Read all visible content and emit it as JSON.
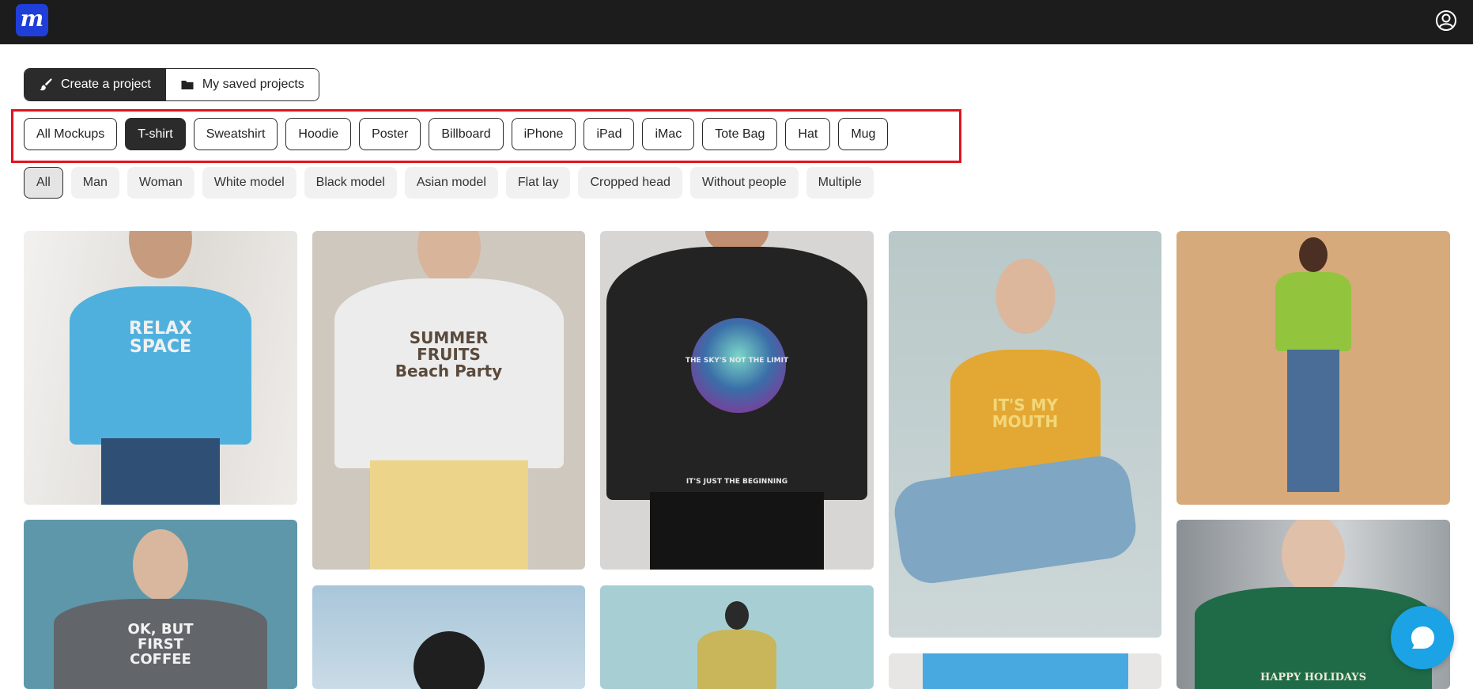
{
  "header": {
    "logo_text": "m",
    "brand_color": "#1f3fd8",
    "account_icon": "user-circle-icon"
  },
  "project_tabs": [
    {
      "label": "Create a project",
      "icon": "brush-icon",
      "active": true
    },
    {
      "label": "My saved projects",
      "icon": "folder-icon",
      "active": false
    }
  ],
  "categories": [
    {
      "label": "All Mockups",
      "active": false
    },
    {
      "label": "T-shirt",
      "active": true
    },
    {
      "label": "Sweatshirt",
      "active": false
    },
    {
      "label": "Hoodie",
      "active": false
    },
    {
      "label": "Poster",
      "active": false
    },
    {
      "label": "Billboard",
      "active": false
    },
    {
      "label": "iPhone",
      "active": false
    },
    {
      "label": "iPad",
      "active": false
    },
    {
      "label": "iMac",
      "active": false
    },
    {
      "label": "Tote Bag",
      "active": false
    },
    {
      "label": "Hat",
      "active": false
    },
    {
      "label": "Mug",
      "active": false
    }
  ],
  "filters": [
    {
      "label": "All",
      "active": true
    },
    {
      "label": "Man",
      "active": false
    },
    {
      "label": "Woman",
      "active": false
    },
    {
      "label": "White model",
      "active": false
    },
    {
      "label": "Black model",
      "active": false
    },
    {
      "label": "Asian model",
      "active": false
    },
    {
      "label": "Flat lay",
      "active": false
    },
    {
      "label": "Cropped head",
      "active": false
    },
    {
      "label": "Without people",
      "active": false
    },
    {
      "label": "Multiple",
      "active": false
    }
  ],
  "gallery": [
    {
      "print": "RELAX\nSPACE",
      "shirt_color": "#4fb0de",
      "bg": "#e9e7e4"
    },
    {
      "print": "SUMMER\nFRUITS\nBeach Party",
      "shirt_color": "#ececec",
      "bg": "#cfc8bf"
    },
    {
      "print": "THE SKY'S NOT THE LIMIT\nIT'S JUST THE BEGINNING",
      "shirt_color": "#232323",
      "bg": "#d8d6d4"
    },
    {
      "print": "IT'S MY\nMOUTH",
      "shirt_color": "#e3a834",
      "bg": "#b9c8c8"
    },
    {
      "print": "",
      "shirt_color": "#93c43e",
      "bg": "#d7aa7c"
    },
    {
      "print": "OK, BUT\nFIRST\nCOFFEE",
      "shirt_color": "#62666a",
      "bg": "#5f97aa"
    },
    {
      "print": "",
      "shirt_color": "#2a2a2a",
      "bg": "#a9c6da"
    },
    {
      "print": "",
      "shirt_color": "#c9b55a",
      "bg": "#a7cfd3"
    },
    {
      "print": "",
      "shirt_color": "#48a9e0",
      "bg": "#e8e6e4"
    },
    {
      "print": "HAPPY HOLIDAYS",
      "shirt_color": "#1f6b47",
      "bg": "#8a8f94"
    }
  ],
  "chat": {
    "icon": "chat-bubble-icon",
    "color": "#1ba3e6"
  }
}
